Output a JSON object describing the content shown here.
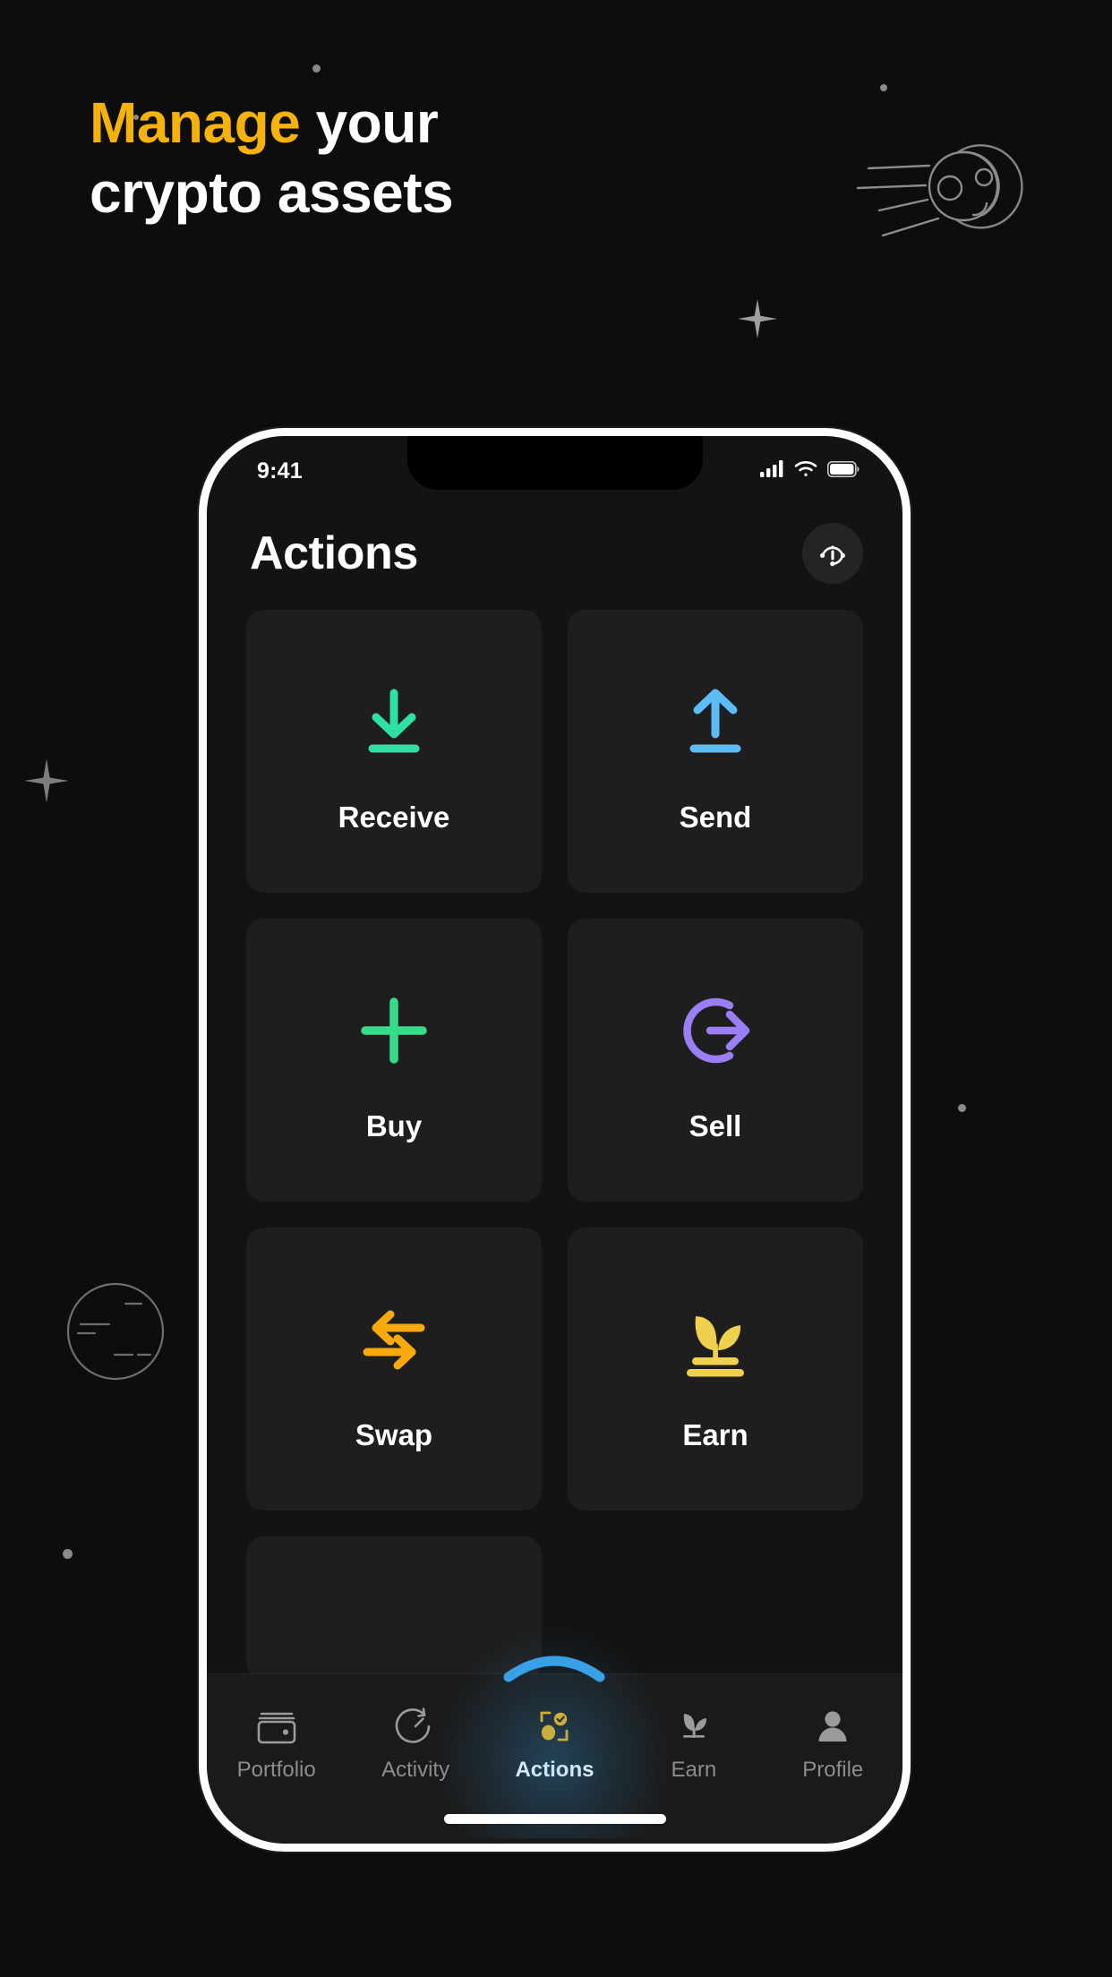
{
  "promo": {
    "headline_accent": "Manage",
    "headline_rest": "your",
    "headline_line2": "crypto assets",
    "accent_color": "#f5b20a",
    "background_color": "#0d0d0d",
    "decorations": [
      "comet-illustration",
      "planet-illustration",
      "sparkle-star",
      "star-dot"
    ]
  },
  "phone": {
    "status_bar": {
      "time": "9:41",
      "icons": [
        "cellular-signal-icon",
        "wifi-icon",
        "battery-icon"
      ]
    },
    "header": {
      "title": "Actions",
      "support_icon": "support-headset-info-icon"
    },
    "actions": [
      {
        "label": "Receive",
        "icon": "arrow-down-to-line-icon",
        "color": "#2ee0a6"
      },
      {
        "label": "Send",
        "icon": "arrow-up-from-line-icon",
        "color": "#5bbdf5"
      },
      {
        "label": "Buy",
        "icon": "plus-icon",
        "color": "#35dd8b"
      },
      {
        "label": "Sell",
        "icon": "circle-arrow-out-right-icon",
        "color": "#9b7df5"
      },
      {
        "label": "Swap",
        "icon": "swap-arrows-icon",
        "color": "#f9a90b"
      },
      {
        "label": "Earn",
        "icon": "sprout-plant-icon",
        "color": "#f0d14e"
      }
    ],
    "tabs": [
      {
        "label": "Portfolio",
        "icon": "wallet-icon",
        "active": false
      },
      {
        "label": "Activity",
        "icon": "speedometer-icon",
        "active": false
      },
      {
        "label": "Actions",
        "icon": "actions-frame-icon",
        "active": true
      },
      {
        "label": "Earn",
        "icon": "plant-icon",
        "active": false
      },
      {
        "label": "Profile",
        "icon": "person-icon",
        "active": false
      }
    ],
    "active_tab_accent": "#f5b20a",
    "tab_indicator_color": "#38a0e6",
    "home_indicator": true
  }
}
